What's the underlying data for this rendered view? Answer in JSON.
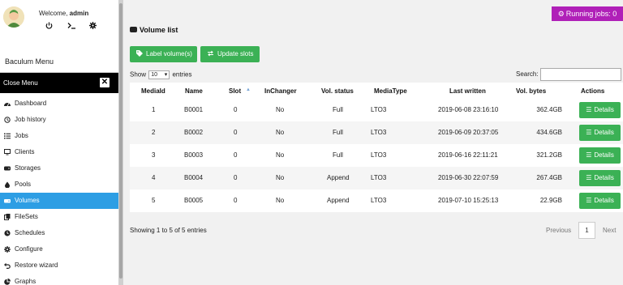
{
  "user": {
    "welcome_prefix": "Welcome,",
    "username": "admin",
    "icons": [
      "power-icon",
      "terminal-icon",
      "gear-icon"
    ]
  },
  "sidebar": {
    "title": "Baculum Menu",
    "close_label": "Close Menu",
    "items": [
      {
        "label": "Dashboard",
        "icon": "dashboard-icon"
      },
      {
        "label": "Job history",
        "icon": "history-icon"
      },
      {
        "label": "Jobs",
        "icon": "list-icon"
      },
      {
        "label": "Clients",
        "icon": "desktop-icon"
      },
      {
        "label": "Storages",
        "icon": "database-icon"
      },
      {
        "label": "Pools",
        "icon": "pool-icon"
      },
      {
        "label": "Volumes",
        "icon": "hdd-icon",
        "active": true
      },
      {
        "label": "FileSets",
        "icon": "files-icon"
      },
      {
        "label": "Schedules",
        "icon": "clock-icon"
      },
      {
        "label": "Configure",
        "icon": "wrench-icon"
      },
      {
        "label": "Restore wizard",
        "icon": "undo-icon"
      },
      {
        "label": "Graphs",
        "icon": "pie-chart-icon"
      }
    ]
  },
  "header": {
    "running_jobs": "Running jobs: 0"
  },
  "main": {
    "title": "Volume list",
    "buttons": {
      "label_volume": "Label volume(s)",
      "update_slots": "Update slots"
    },
    "show_prefix": "Show",
    "show_value": "10",
    "show_suffix": "entries",
    "search_label": "Search:",
    "search_value": "",
    "columns": [
      "MediaId",
      "Name",
      "Slot",
      "InChanger",
      "Vol. status",
      "MediaType",
      "Last written",
      "Vol. bytes",
      "Actions"
    ],
    "rows": [
      {
        "mediaid": "1",
        "name": "B0001",
        "slot": "0",
        "inchanger": "No",
        "status": "Full",
        "mediatype": "LTO3",
        "last_written": "2019-06-08 23:16:10",
        "bytes": "362.4GB",
        "action": "Details"
      },
      {
        "mediaid": "2",
        "name": "B0002",
        "slot": "0",
        "inchanger": "No",
        "status": "Full",
        "mediatype": "LTO3",
        "last_written": "2019-06-09 20:37:05",
        "bytes": "434.6GB",
        "action": "Details"
      },
      {
        "mediaid": "3",
        "name": "B0003",
        "slot": "0",
        "inchanger": "No",
        "status": "Full",
        "mediatype": "LTO3",
        "last_written": "2019-06-16 22:11:21",
        "bytes": "321.2GB",
        "action": "Details"
      },
      {
        "mediaid": "4",
        "name": "B0004",
        "slot": "0",
        "inchanger": "No",
        "status": "Append",
        "mediatype": "LTO3",
        "last_written": "2019-06-30 22:07:59",
        "bytes": "267.4GB",
        "action": "Details"
      },
      {
        "mediaid": "5",
        "name": "B0005",
        "slot": "0",
        "inchanger": "No",
        "status": "Append",
        "mediatype": "LTO3",
        "last_written": "2019-07-10 15:25:13",
        "bytes": "22.9GB",
        "action": "Details"
      }
    ],
    "info": "Showing 1 to 5 of 5 entries",
    "pager": {
      "prev": "Previous",
      "page": "1",
      "next": "Next"
    }
  },
  "colors": {
    "accent_blue": "#2d9ee4",
    "green": "#3bb155",
    "purple": "#b020b8"
  }
}
